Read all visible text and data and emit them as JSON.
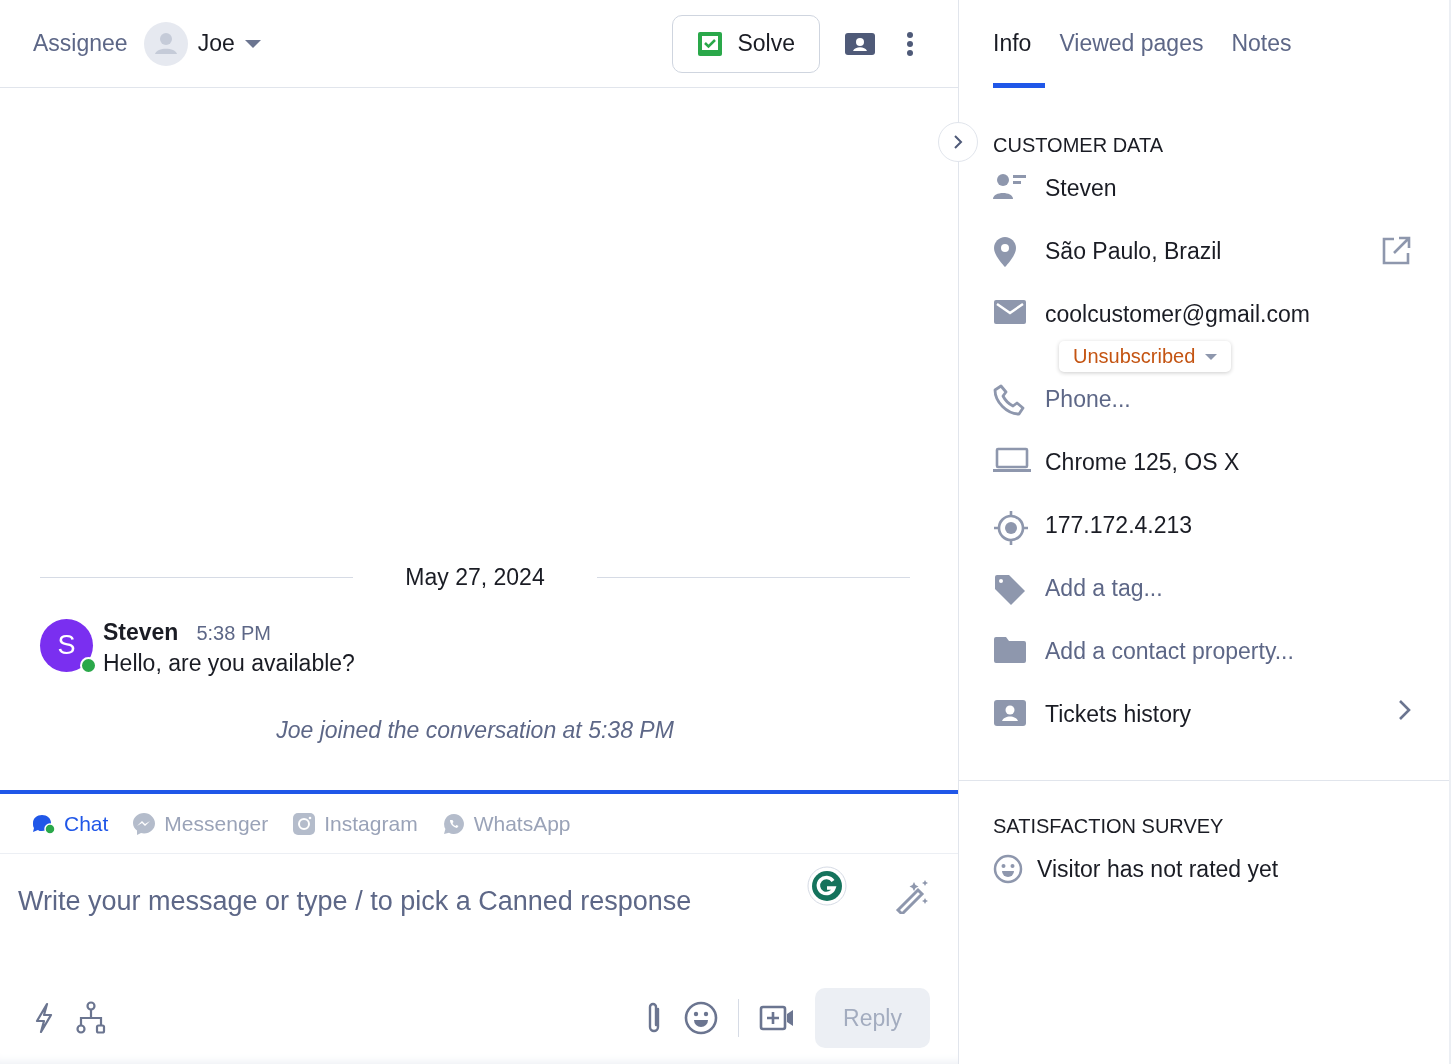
{
  "header": {
    "assignee_label": "Assignee",
    "assignee": "Joe",
    "solve": "Solve"
  },
  "side_tabs": [
    {
      "label": "Info",
      "selected": true
    },
    {
      "label": "Viewed pages",
      "selected": false
    },
    {
      "label": "Notes",
      "selected": false
    }
  ],
  "conversation": {
    "date": "May 27, 2024",
    "message": {
      "avatar": "S",
      "author": "Steven",
      "time": "5:38 PM",
      "text": "Hello, are you available?",
      "online": true
    },
    "event": "Joe joined the conversation at 5:38 PM"
  },
  "channels": [
    {
      "kind": "chat",
      "label": "Chat",
      "selected": true
    },
    {
      "kind": "messenger",
      "label": "Messenger",
      "selected": false
    },
    {
      "kind": "instagram",
      "label": "Instagram",
      "selected": false
    },
    {
      "kind": "whatsapp",
      "label": "WhatsApp",
      "selected": false
    }
  ],
  "composer": {
    "placeholder": "Write your message or type / to pick a Canned response",
    "reply": "Reply",
    "reply_disabled": true
  },
  "customer_data": {
    "title": "CUSTOMER DATA",
    "rows": [
      {
        "kind": "person",
        "text": "Steven",
        "empty": false
      },
      {
        "kind": "location",
        "text": "São Paulo, Brazil",
        "empty": false
      },
      {
        "kind": "email",
        "text": "coolcustomer@gmail.com",
        "empty": false,
        "subscription": "Unsubscribed"
      },
      {
        "kind": "phone",
        "text": "Phone...",
        "empty": true
      },
      {
        "kind": "device",
        "text": "Chrome 125, OS X",
        "empty": false
      },
      {
        "kind": "ip",
        "text": "177.172.4.213",
        "empty": false
      },
      {
        "kind": "tag",
        "text": "Add a tag...",
        "empty": true
      },
      {
        "kind": "folder",
        "text": "Add a contact property...",
        "empty": true
      },
      {
        "kind": "tickets",
        "text": "Tickets history",
        "empty": false
      }
    ]
  },
  "survey": {
    "title": "SATISFACTION SURVEY",
    "text": "Visitor has not rated yet"
  }
}
